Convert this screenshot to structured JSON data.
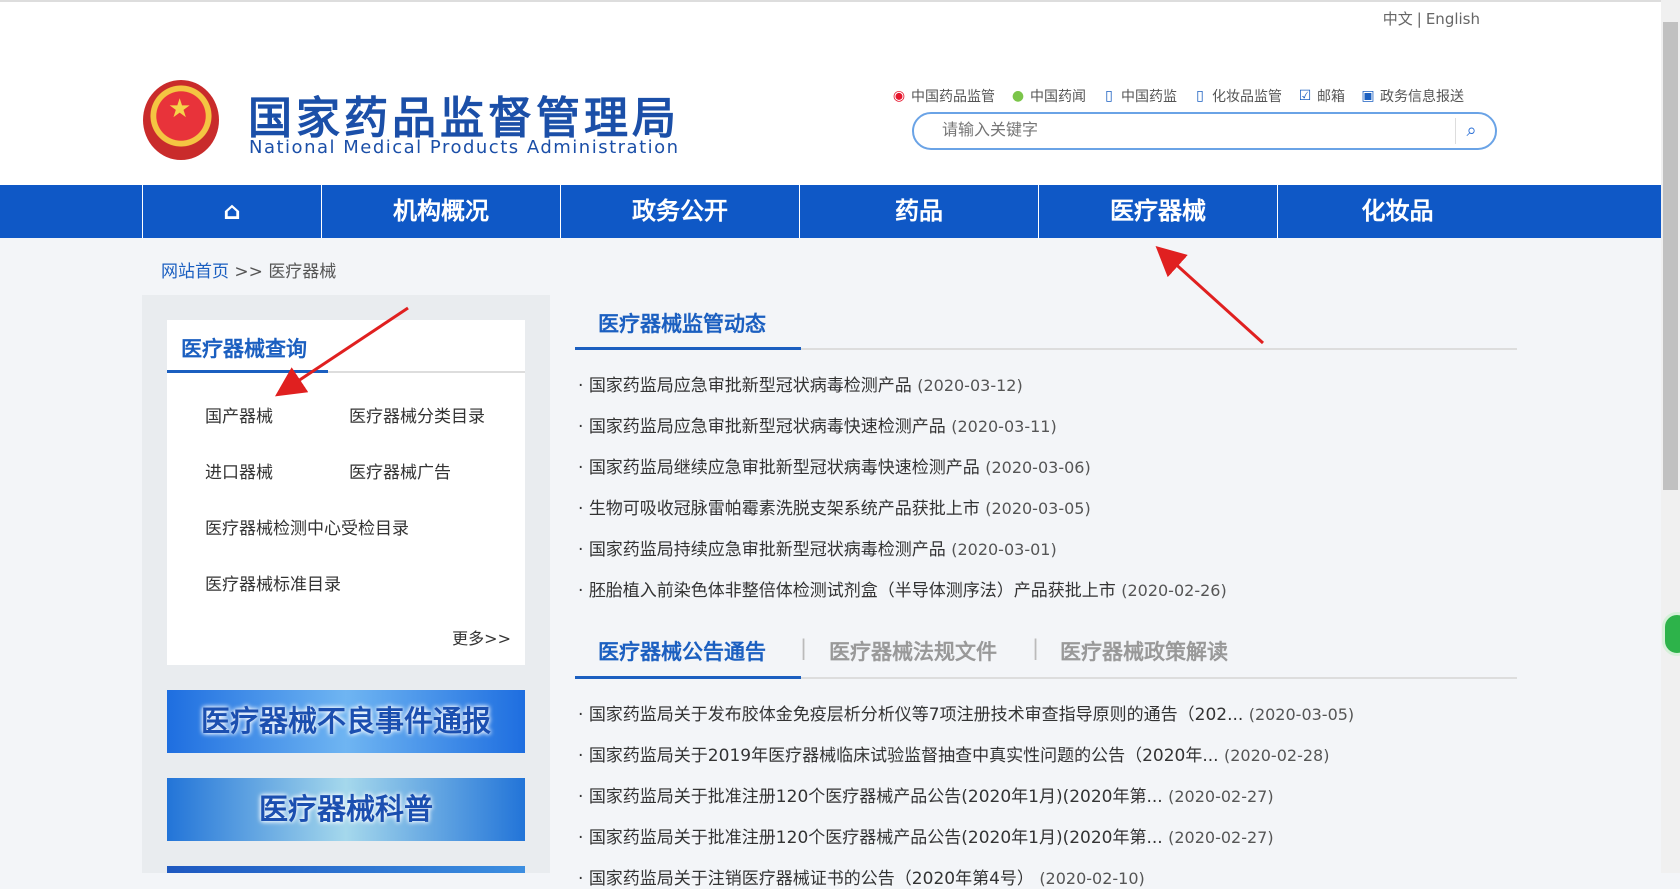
{
  "header": {
    "lang": [
      "中文",
      "English"
    ],
    "title": "国家药品监督管理局",
    "subtitle": "National Medical Products Administration",
    "social": [
      {
        "icon": "weibo-icon",
        "label": "中国药品监管"
      },
      {
        "icon": "wechat-icon",
        "label": "中国药闻"
      },
      {
        "icon": "mobile-icon",
        "label": "中国药监"
      },
      {
        "icon": "mobile-icon",
        "label": "化妆品监管"
      },
      {
        "icon": "mail-icon",
        "label": "邮箱"
      },
      {
        "icon": "monitor-icon",
        "label": "政务信息报送"
      }
    ],
    "search_placeholder": "请输入关键字"
  },
  "nav": {
    "items": [
      "机构概况",
      "政务公开",
      "药品",
      "医疗器械",
      "化妆品"
    ]
  },
  "breadcrumb": {
    "home": "网站首页",
    "sep": ">>",
    "current": "医疗器械"
  },
  "query": {
    "title": "医疗器械查询",
    "links": [
      "国产器械",
      "医疗器械分类目录",
      "进口器械",
      "医疗器械广告",
      "医疗器械检测中心受检目录",
      "医疗器械标准目录"
    ],
    "more": "更多>>"
  },
  "banners": [
    "医疗器械不良事件通报",
    "医疗器械科普"
  ],
  "dynamics": {
    "title": "医疗器械监管动态",
    "items": [
      {
        "t": "国家药监局应急审批新型冠状病毒检测产品",
        "d": "(2020-03-12)"
      },
      {
        "t": "国家药监局应急审批新型冠状病毒快速检测产品",
        "d": "(2020-03-11)"
      },
      {
        "t": "国家药监局继续应急审批新型冠状病毒快速检测产品",
        "d": "(2020-03-06)"
      },
      {
        "t": "生物可吸收冠脉雷帕霉素洗脱支架系统产品获批上市",
        "d": "(2020-03-05)"
      },
      {
        "t": "国家药监局持续应急审批新型冠状病毒检测产品",
        "d": "(2020-03-01)"
      },
      {
        "t": "胚胎植入前染色体非整倍体检测试剂盒（半导体测序法）产品获批上市",
        "d": "(2020-02-26)"
      }
    ]
  },
  "notices": {
    "tabs": [
      "医疗器械公告通告",
      "医疗器械法规文件",
      "医疗器械政策解读"
    ],
    "items": [
      {
        "t": "国家药监局关于发布胶体金免疫层析分析仪等7项注册技术审查指导原则的通告（202...",
        "d": "(2020-03-05)"
      },
      {
        "t": "国家药监局关于2019年医疗器械临床试验监督抽查中真实性问题的公告（2020年...",
        "d": "(2020-02-28)"
      },
      {
        "t": "国家药监局关于批准注册120个医疗器械产品公告(2020年1月)(2020年第...",
        "d": "(2020-02-27)"
      },
      {
        "t": "国家药监局关于批准注册120个医疗器械产品公告(2020年1月)(2020年第...",
        "d": "(2020-02-27)"
      },
      {
        "t": "国家药监局关于注销医疗器械证书的公告（2020年第4号）",
        "d": "(2020-02-10)"
      }
    ]
  },
  "colors": {
    "brand": "#0f58c6",
    "annotation_arrow": "#e02020"
  }
}
